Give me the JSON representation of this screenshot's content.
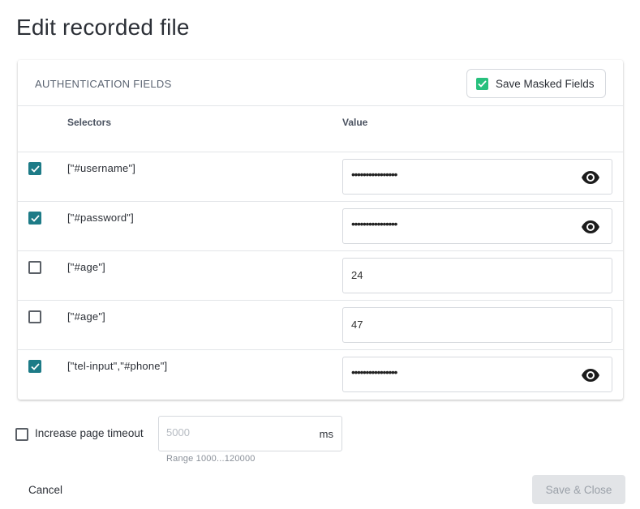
{
  "page": {
    "title": "Edit recorded file"
  },
  "auth": {
    "section_label": "AUTHENTICATION FIELDS",
    "save_masked": {
      "label": "Save Masked Fields",
      "checked": true
    },
    "columns": {
      "selectors": "Selectors",
      "value": "Value"
    },
    "rows": [
      {
        "checked": true,
        "selector": "[\"#username\"]",
        "value": "••••••••••••••••",
        "masked": true,
        "icon": "eye-icon"
      },
      {
        "checked": true,
        "selector": "[\"#password\"]",
        "value": "••••••••••••••••",
        "masked": true,
        "icon": "eye-icon"
      },
      {
        "checked": false,
        "selector": "[\"#age\"]",
        "value": "24",
        "masked": false
      },
      {
        "checked": false,
        "selector": "[\"#age\"]",
        "value": "47",
        "masked": false
      },
      {
        "checked": true,
        "selector": "[\"tel-input\",\"#phone\"]",
        "value": "••••••••••••••••",
        "masked": true,
        "icon": "eye-icon"
      }
    ]
  },
  "timeout": {
    "checkbox_label": "Increase page timeout",
    "checked": false,
    "placeholder": "5000",
    "unit": "ms",
    "hint": "Range 1000...120000"
  },
  "footer": {
    "cancel_label": "Cancel",
    "save_label": "Save & Close"
  },
  "colors": {
    "checkbox_teal": "#1d7b87",
    "mask_green": "#27c07d",
    "disabled_bg": "#e2e4e7"
  }
}
